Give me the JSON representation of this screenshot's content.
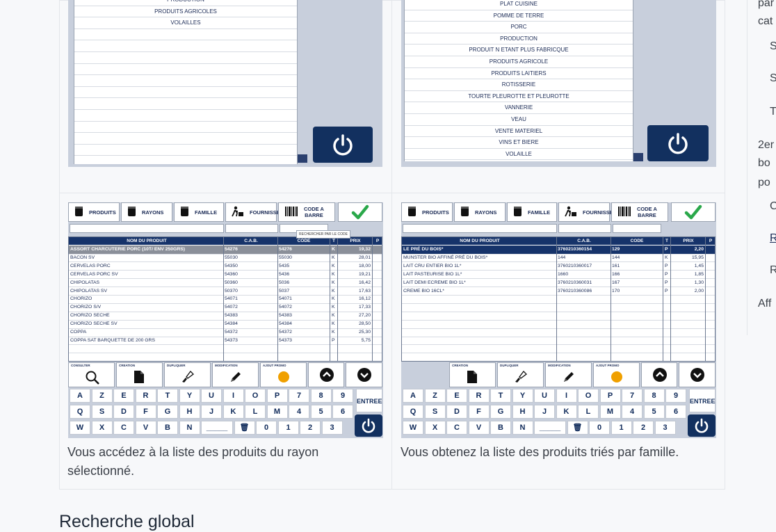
{
  "left_top_list": [
    "PRODUCTION",
    "PRODUITS AGRICOLES",
    "VOLAILLES"
  ],
  "right_top_list": [
    "PLAT CUISINE",
    "POMME DE TERRE",
    "PORC",
    "PRODUCTION",
    "PRODUIT N ETANT PLUS FABRICQUE",
    "PRODUITS AGRICOLE",
    "PRODUITS LAITIERS",
    "ROTISSERIE",
    "TOURTE PLEUROTTE  ET PLEUROTTE",
    "VANNERIE",
    "VEAU",
    "VENTE MATERIEL",
    "VINS  ET BIERE",
    "VOLAILLE"
  ],
  "toolbar": {
    "produits": "PRODUITS",
    "rayons": "RAYONS",
    "famille": "FAMILLE",
    "fournisseur": "FOURNISSEUR",
    "code_barre_1": "CODE A",
    "code_barre_2": "BARRE",
    "tooltip": "RECHERCHER PAR LE CODE"
  },
  "table_headers": {
    "nom": "NOM DU PRODUIT",
    "cab": "C.A.B.",
    "code": "CODE",
    "t": "T",
    "prix": "PRIX",
    "p": "P"
  },
  "left_products": [
    {
      "nom": "ASSORT CHARCUTERIE PORC (10T/ ENV 250GRS)",
      "cab": "54276",
      "code": "54276",
      "t": "K",
      "prix": "19,32"
    },
    {
      "nom": "BACON SV",
      "cab": "55030",
      "code": "55030",
      "t": "K",
      "prix": "28,01"
    },
    {
      "nom": "CERVELAS PORC",
      "cab": "54350",
      "code": "5435",
      "t": "K",
      "prix": "18,00"
    },
    {
      "nom": "CERVELAS PORC SV",
      "cab": "54360",
      "code": "5436",
      "t": "K",
      "prix": "19,21"
    },
    {
      "nom": "CHIPOLATAS",
      "cab": "50360",
      "code": "5036",
      "t": "K",
      "prix": "16,42"
    },
    {
      "nom": "CHIPOLATAS SV",
      "cab": "50370",
      "code": "5037",
      "t": "K",
      "prix": "17,63"
    },
    {
      "nom": "CHORIZO",
      "cab": "54071",
      "code": "54071",
      "t": "K",
      "prix": "16,12"
    },
    {
      "nom": "CHORIZO S/V",
      "cab": "54072",
      "code": "54072",
      "t": "K",
      "prix": "17,33"
    },
    {
      "nom": "CHORIZO SECHE",
      "cab": "54383",
      "code": "54383",
      "t": "K",
      "prix": "27,20"
    },
    {
      "nom": "CHORIZO SECHE SV",
      "cab": "54384",
      "code": "54384",
      "t": "K",
      "prix": "28,50"
    },
    {
      "nom": "COPPA",
      "cab": "54372",
      "code": "54372",
      "t": "K",
      "prix": "25,30"
    },
    {
      "nom": "COPPA SAT BARQUETTE DE 200 GRS",
      "cab": "54373",
      "code": "54373",
      "t": "P",
      "prix": "5,75"
    }
  ],
  "right_products": [
    {
      "nom": "LE PRÉ DU BOIS*",
      "cab": "3760210360154",
      "code": "129",
      "t": "P",
      "prix": "2,20"
    },
    {
      "nom": "MUNSTER BIO AFFINÉ PRÉ DU BOIS*",
      "cab": "144",
      "code": "144",
      "t": "K",
      "prix": "15,95"
    },
    {
      "nom": "LAIT CRU ENTIER BIO 1L*",
      "cab": "3760210360017",
      "code": "161",
      "t": "P",
      "prix": "1,45"
    },
    {
      "nom": "LAIT PASTEURISE BIO 1L*",
      "cab": "1660",
      "code": "166",
      "t": "P",
      "prix": "1,85"
    },
    {
      "nom": "LAIT DEMI ECREME BIO 1L*",
      "cab": "3760210360031",
      "code": "167",
      "t": "P",
      "prix": "1,30"
    },
    {
      "nom": "CREME BIO 16CL*",
      "cab": "3760210360086",
      "code": "170",
      "t": "P",
      "prix": "2,00"
    }
  ],
  "actions": {
    "consulter": "CONSULTER",
    "creation": "CREATION",
    "dupliquer": "DUPLIQUER",
    "modification": "MODIFICATION",
    "ajout_promo": "AJOUT PROMO"
  },
  "keyboard": {
    "row1": [
      "A",
      "Z",
      "E",
      "R",
      "T",
      "Y",
      "U",
      "I",
      "O",
      "P",
      "7",
      "8",
      "9"
    ],
    "row2": [
      "Q",
      "S",
      "D",
      "F",
      "G",
      "H",
      "J",
      "K",
      "L",
      "M",
      "4",
      "5",
      "6"
    ],
    "row3": [
      "W",
      "X",
      "C",
      "V",
      "B",
      "N",
      "_____",
      "🗑",
      "0",
      "1",
      "2",
      "3"
    ],
    "entree": "ENTREE"
  },
  "captions": {
    "left": "Vous accédez à la liste des produits du rayon sélectionné.",
    "right": "Vous obtenez la liste des produits triés par famille."
  },
  "heading": "Recherche global",
  "side": {
    "l1": "par",
    "l2": "cat",
    "l3": "S",
    "l4": "S",
    "l5": "T",
    "l6": "2er",
    "l7": "bo",
    "l8": "po",
    "l9": "C",
    "l10": "R",
    "l11": "R",
    "l12": "Aff"
  },
  "colors": {
    "navy": "#16336a",
    "green_check": "#2aa84a",
    "promo_orange": "#f0a000"
  }
}
